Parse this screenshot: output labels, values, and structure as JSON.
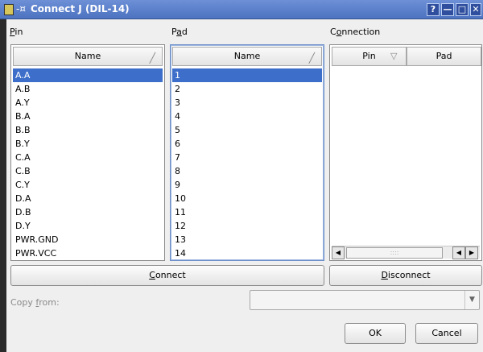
{
  "window": {
    "title": "Connect J (DIL-14)",
    "pin_glyph": "-¤",
    "help_glyph": "?",
    "minimize_glyph": "—",
    "maximize_glyph": "□",
    "close_glyph": "✕"
  },
  "labels": {
    "pin_first": "P",
    "pin_rest": "in",
    "pad_first": "P",
    "pad_u": "a",
    "pad_rest": "d",
    "connection_first": "C",
    "connection_u": "o",
    "connection_rest": "nnection"
  },
  "pin_list": {
    "header": "Name",
    "sort_icon": "╱",
    "items": [
      "A.A",
      "A.B",
      "A.Y",
      "B.A",
      "B.B",
      "B.Y",
      "C.A",
      "C.B",
      "C.Y",
      "D.A",
      "D.B",
      "D.Y",
      "PWR.GND",
      "PWR.VCC"
    ],
    "selected_index": 0
  },
  "pad_list": {
    "header": "Name",
    "sort_icon": "╱",
    "items": [
      "1",
      "2",
      "3",
      "4",
      "5",
      "6",
      "7",
      "8",
      "9",
      "10",
      "11",
      "12",
      "13",
      "14"
    ],
    "selected_index": 0
  },
  "connection": {
    "col_pin": "Pin",
    "col_pad": "Pad",
    "sort_icon": "▽",
    "scroll_left": "◀",
    "scroll_right": "▶",
    "scroll_grip": "::::"
  },
  "buttons": {
    "connect_u": "C",
    "connect_rest": "onnect",
    "disconnect_u": "D",
    "disconnect_rest": "isconnect",
    "ok": "OK",
    "cancel": "Cancel"
  },
  "copy_from": {
    "label_pre": "Copy ",
    "label_u": "f",
    "label_rest": "rom:",
    "value": "",
    "arrow": "▼"
  },
  "colors": {
    "titlebar": "#4d72c0",
    "selection": "#3d6ec9",
    "focus_border": "#6c8ec9"
  }
}
